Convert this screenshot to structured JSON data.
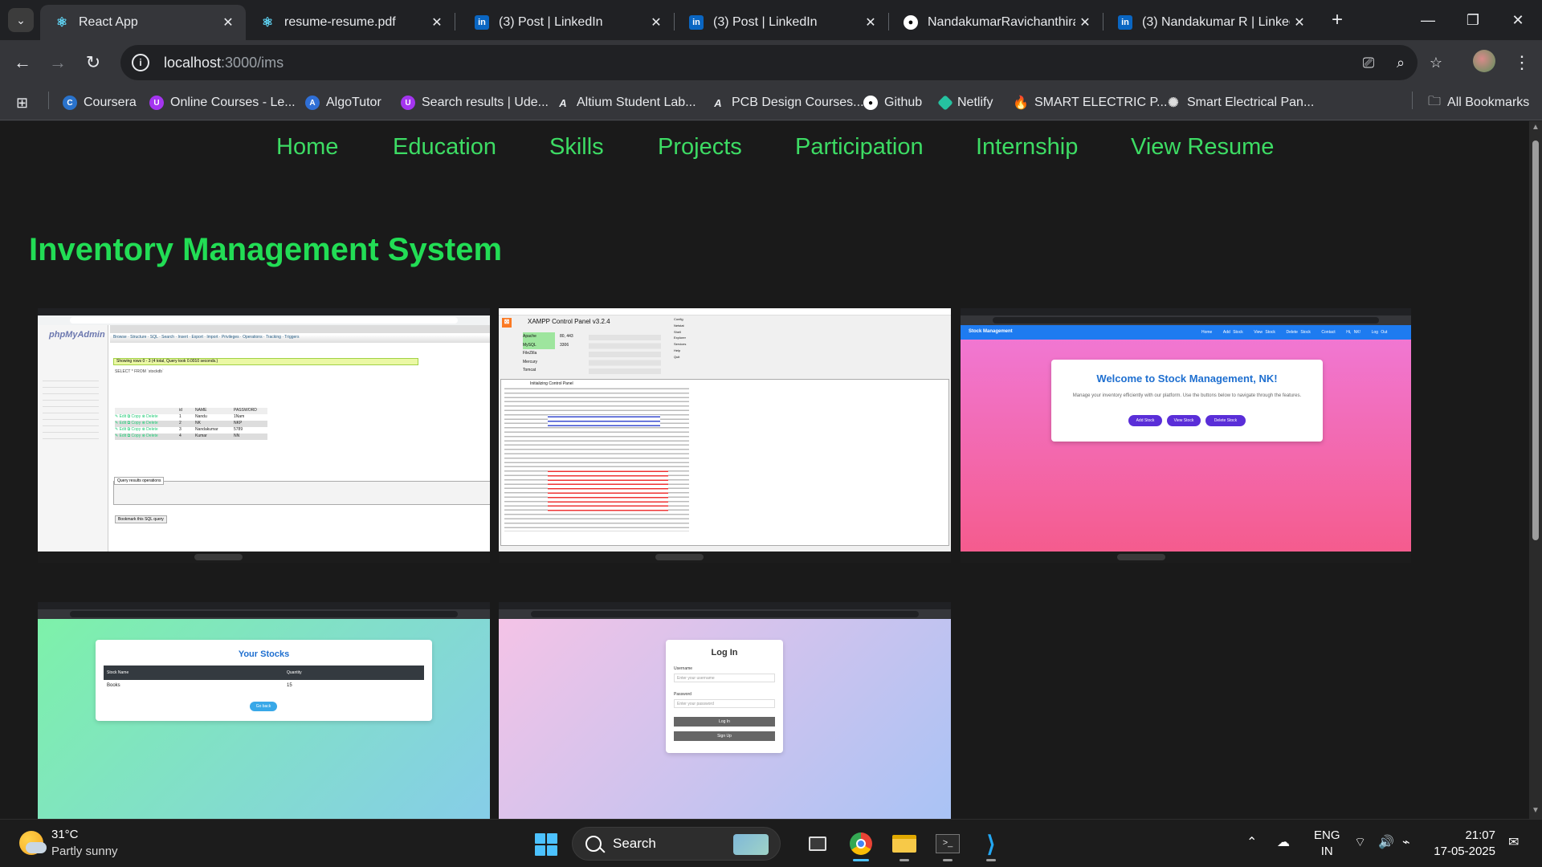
{
  "tabs": [
    {
      "label": "React App",
      "icon": "react-icon"
    },
    {
      "label": "resume-resume.pdf",
      "icon": "react-icon"
    },
    {
      "label": "(3) Post | LinkedIn",
      "icon": "linkedin-icon"
    },
    {
      "label": "(3) Post | LinkedIn",
      "icon": "linkedin-icon"
    },
    {
      "label": "NandakumarRavichanthiran",
      "icon": "github-icon"
    },
    {
      "label": "(3) Nandakumar R | LinkedIn",
      "icon": "linkedin-icon"
    }
  ],
  "address": {
    "host": "localhost",
    "path": ":3000/ims"
  },
  "bookmarks": [
    {
      "label": "Coursera",
      "icon": "coursera-icon",
      "color": "#2a73cc"
    },
    {
      "label": "Online Courses - Le...",
      "icon": "udemy-icon",
      "color": "#a435f0"
    },
    {
      "label": "AlgoTutor",
      "icon": "algotutor-icon",
      "color": "#2f6fd6"
    },
    {
      "label": "Search results | Ude...",
      "icon": "udemy-icon",
      "color": "#a435f0"
    },
    {
      "label": "Altium Student Lab...",
      "icon": "altium-icon",
      "color": "#cccccc"
    },
    {
      "label": "PCB Design Courses...",
      "icon": "altium-icon",
      "color": "#cccccc"
    },
    {
      "label": "Github",
      "icon": "github-icon",
      "color": "#ffffff"
    },
    {
      "label": "Netlify",
      "icon": "netlify-icon",
      "color": "#25c2a0"
    },
    {
      "label": "SMART ELECTRIC P...",
      "icon": "flame-icon",
      "color": "#ff5722"
    },
    {
      "label": "Smart Electrical Pan...",
      "icon": "openai-icon",
      "color": "#dddddd"
    }
  ],
  "all_bookmarks": "All Bookmarks",
  "nav": [
    "Home",
    "Education",
    "Skills",
    "Projects",
    "Participation",
    "Internship",
    "View Resume"
  ],
  "page_title": "Inventory Management System",
  "shots": {
    "phpmyadmin": {
      "logo": "phpMyAdmin",
      "query_ok": "Showing rows 0 - 3 (4 total, Query took 0.0010 seconds.)",
      "sql": "SELECT * FROM `stockdb`",
      "col_id": "id",
      "col_name": "NAME",
      "col_pass": "PASSWORD",
      "tabs": [
        "Browse",
        "Structure",
        "SQL",
        "Search",
        "Insert",
        "Export",
        "Import",
        "Privileges",
        "Operations",
        "Tracking",
        "Triggers"
      ],
      "rows": [
        {
          "id": "1",
          "name": "Nandu",
          "pass": "1Nam"
        },
        {
          "id": "2",
          "name": "NK",
          "pass": "NKP"
        },
        {
          "id": "3",
          "name": "Nandakumar",
          "pass": "5789"
        },
        {
          "id": "4",
          "name": "Kumar",
          "pass": "NN"
        }
      ],
      "query_results": "Query results operations",
      "bookmark": "Bookmark this SQL query"
    },
    "xampp": {
      "title": "XAMPP Control Panel v3.2.4",
      "modules": [
        "Apache",
        "MySQL",
        "FileZilla",
        "Mercury",
        "Tomcat"
      ],
      "ports": [
        "80, 443",
        "3306",
        "",
        "",
        ""
      ],
      "log_title": "Initializing Control Panel",
      "side_buttons": [
        "Config",
        "Netstat",
        "Shell",
        "Explorer",
        "Services",
        "Help",
        "Quit"
      ]
    },
    "stock_home": {
      "brand": "Stock Management",
      "links": [
        "Home",
        "Add Stock",
        "View Stock",
        "Delete Stock",
        "Contact",
        "Hi, NK!",
        "Log Out"
      ],
      "welcome": "Welcome to Stock Management, NK!",
      "desc": "Manage your inventory efficiently with our platform. Use the buttons below to navigate through the features.",
      "buttons": [
        "Add Stock",
        "View Stock",
        "Delete Stock"
      ]
    },
    "your_stocks": {
      "title": "Your Stocks",
      "col1": "Stock Name",
      "col2": "Quantity",
      "row_name": "Books",
      "row_qty": "15",
      "button": "Go back"
    },
    "login": {
      "title": "Log In",
      "user_label": "Username",
      "user_ph": "Enter your username",
      "pass_label": "Password",
      "pass_ph": "Enter your password",
      "login_btn": "Log In",
      "signup_btn": "Sign Up"
    }
  },
  "taskbar": {
    "temp": "31°C",
    "weather": "Partly sunny",
    "search": "Search",
    "lang1": "ENG",
    "lang2": "IN",
    "time": "21:07",
    "date": "17-05-2025"
  }
}
